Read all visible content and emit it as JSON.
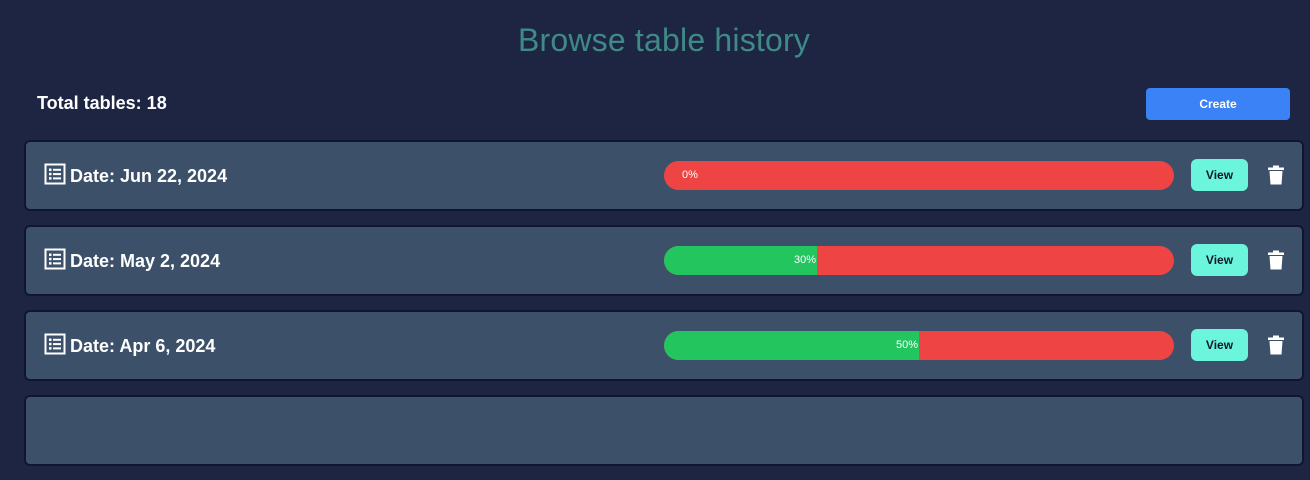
{
  "page": {
    "title": "Browse table history"
  },
  "toolbar": {
    "total_label": "Total tables: 18",
    "create_label": "Create"
  },
  "colors": {
    "complete": "#22c55e",
    "incomplete": "#ef4444",
    "accent": "#3b82f6",
    "view": "#6af5dc"
  },
  "rows": [
    {
      "date": "Date: Jun 22, 2024",
      "progress": 0,
      "progress_label": "0%",
      "view_label": "View",
      "icon": "table-list-icon",
      "action_icon": "trash-icon"
    },
    {
      "date": "Date: May 2, 2024",
      "progress": 30,
      "progress_label": "30%",
      "view_label": "View",
      "icon": "table-list-icon",
      "action_icon": "trash-icon"
    },
    {
      "date": "Date: Apr 6, 2024",
      "progress": 50,
      "progress_label": "50%",
      "view_label": "View",
      "icon": "table-list-icon",
      "action_icon": "trash-icon"
    }
  ]
}
